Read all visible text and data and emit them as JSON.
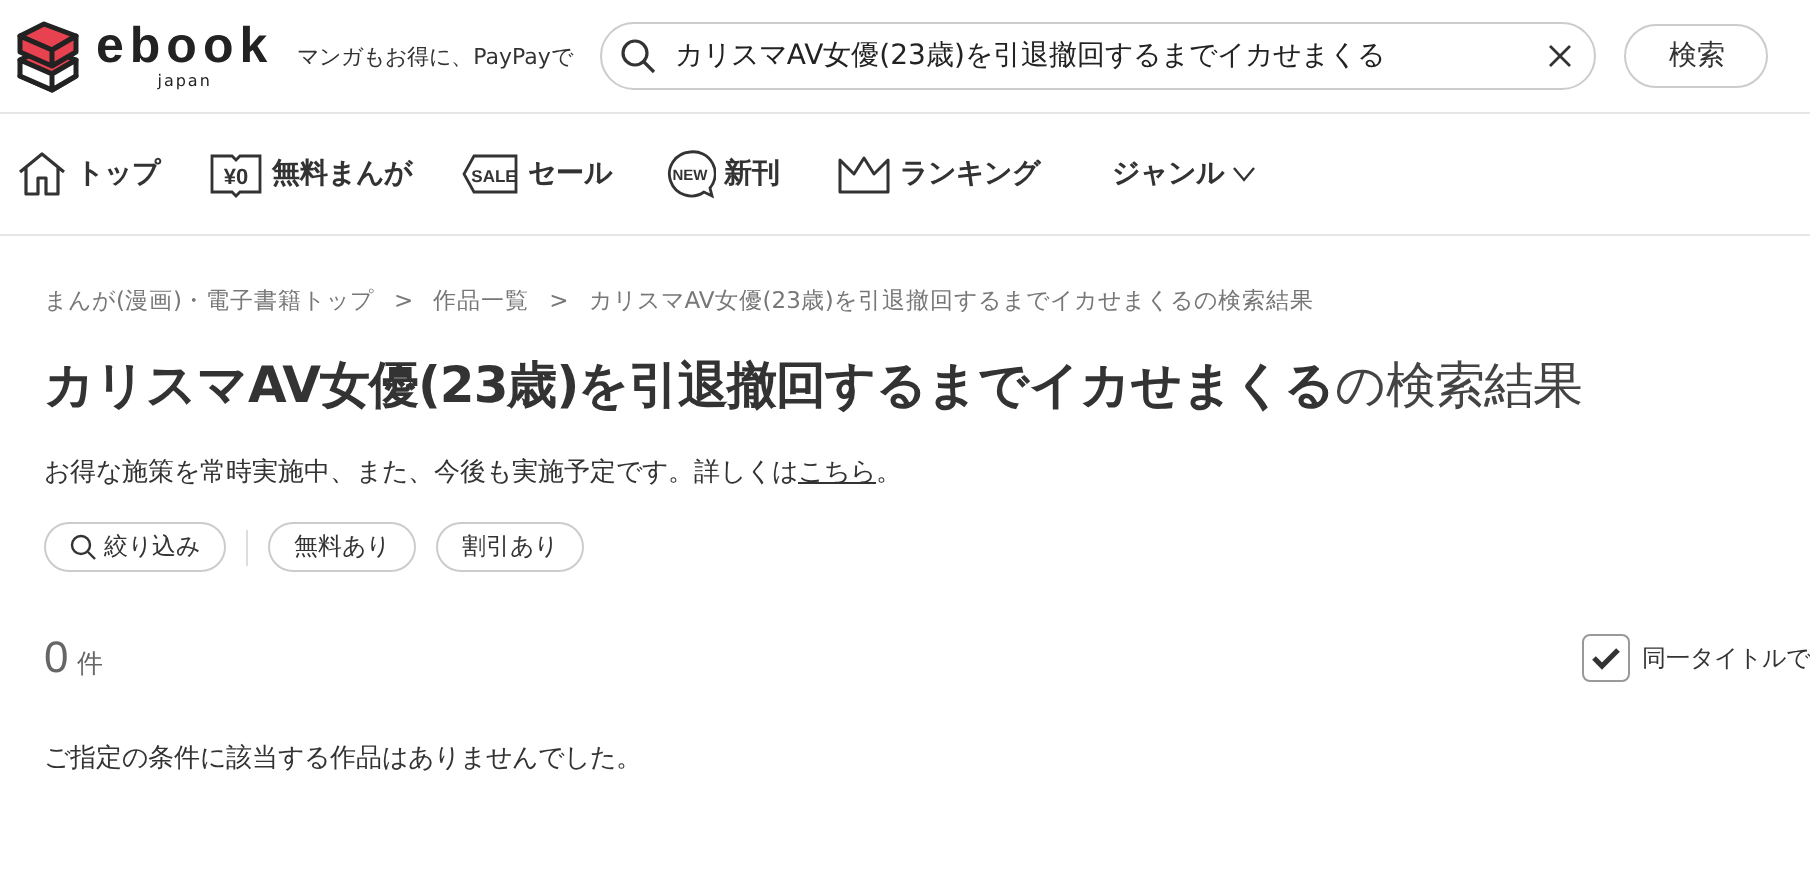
{
  "header": {
    "logo": "ebook",
    "logo_sub": "japan",
    "tagline": "マンガもお得に、PayPayで",
    "search": {
      "value": "カリスマAV女優(23歳)を引退撤回するまでイカせまくる"
    },
    "search_button": "検索"
  },
  "nav": [
    {
      "kind": "home",
      "label": "トップ"
    },
    {
      "kind": "free",
      "label": "無料まんが",
      "badge": "¥0"
    },
    {
      "kind": "sale",
      "label": "セール",
      "badge": "SALE"
    },
    {
      "kind": "new",
      "label": "新刊",
      "badge": "NEW"
    },
    {
      "kind": "ranking",
      "label": "ランキング"
    },
    {
      "kind": "genre",
      "label": "ジャンル"
    }
  ],
  "breadcrumb": [
    "まんが(漫画)・電子書籍トップ",
    "作品一覧",
    "カリスマAV女優(23歳)を引退撤回するまでイカせまくるの検索結果"
  ],
  "breadcrumb_separator": ">",
  "title": "**カリスマAV女優(23歳)を引退撤回するまでイカせまくる**の検索結果",
  "notice": {
    "text": "お得な施策を常時実施中、また、今後も実施予定です。詳しくは",
    "link": "こちら",
    "after": "。"
  },
  "filters": [
    {
      "kind": "search",
      "label": "絞り込み"
    },
    {
      "kind": "chip",
      "label": "無料あり"
    },
    {
      "kind": "chip",
      "label": "割引あり"
    }
  ],
  "count": {
    "number": "0",
    "unit": "件"
  },
  "same_title": {
    "label": "同一タイトルで",
    "checked": true
  },
  "message": "ご指定の条件に該当する作品はありませんでした。"
}
